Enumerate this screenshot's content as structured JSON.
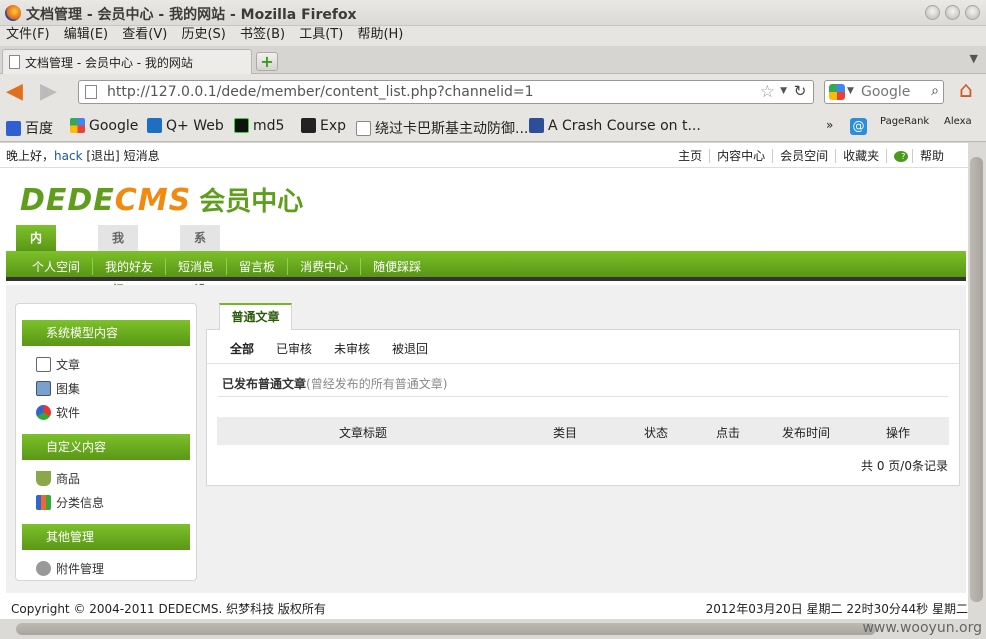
{
  "window": {
    "title": "文档管理 - 会员中心 - 我的网站 - Mozilla Firefox"
  },
  "menu": [
    "文件(F)",
    "编辑(E)",
    "查看(V)",
    "历史(S)",
    "书签(B)",
    "工具(T)",
    "帮助(H)"
  ],
  "tab": {
    "label": "文档管理 - 会员中心 - 我的网站"
  },
  "nav": {
    "url": "http://127.0.0.1/dede/member/content_list.php?channelid=1",
    "search_placeholder": "Google"
  },
  "bookmarks": [
    "百度",
    "Google",
    "Q+ Web",
    "md5",
    "Exp",
    "绕过卡巴斯基主动防御...",
    "A Crash Course on t...",
    "»",
    "PageRank",
    "Alexa"
  ],
  "page": {
    "greeting": "晚上好，",
    "user": "hack",
    "logout": "[退出]",
    "messages": "短消息",
    "top_links": [
      "主页",
      "内容中心",
      "会员空间",
      "收藏夹",
      "帮助"
    ],
    "logo": {
      "part1": "DEDE",
      "part2": "CMS",
      "part3": "会员中心"
    },
    "main_tabs": [
      "内容中心",
      "我的织梦",
      "系统设置"
    ],
    "subnav": [
      "个人空间",
      "我的好友",
      "短消息",
      "留言板",
      "消费中心",
      "随便踩踩"
    ],
    "sidebar": {
      "group1": "系统模型内容",
      "items1": [
        "文章",
        "图集",
        "软件"
      ],
      "group2": "自定义内容",
      "items2": [
        "商品",
        "分类信息"
      ],
      "group3": "其他管理",
      "items3": [
        "附件管理"
      ]
    },
    "content": {
      "tab": "普通文章",
      "filters": [
        "全部",
        "已审核",
        "未审核",
        "被退回"
      ],
      "section_title": "已发布普通文章",
      "section_sub": "(曾经发布的所有普通文章)",
      "columns": [
        "文章标题",
        "类目",
        "状态",
        "点击",
        "发布时间",
        "操作"
      ],
      "pager": "共 0 页/0条记录"
    },
    "footer": {
      "copyright": "Copyright © 2004-2011 DEDECMS. 织梦科技 版权所有",
      "time": "2012年03月20日 星期二 22时30分44秒 星期二"
    }
  },
  "watermark": "www.wooyun.org",
  "colors": {
    "accent_green": "#6aab20",
    "logo_orange": "#f08a10"
  }
}
